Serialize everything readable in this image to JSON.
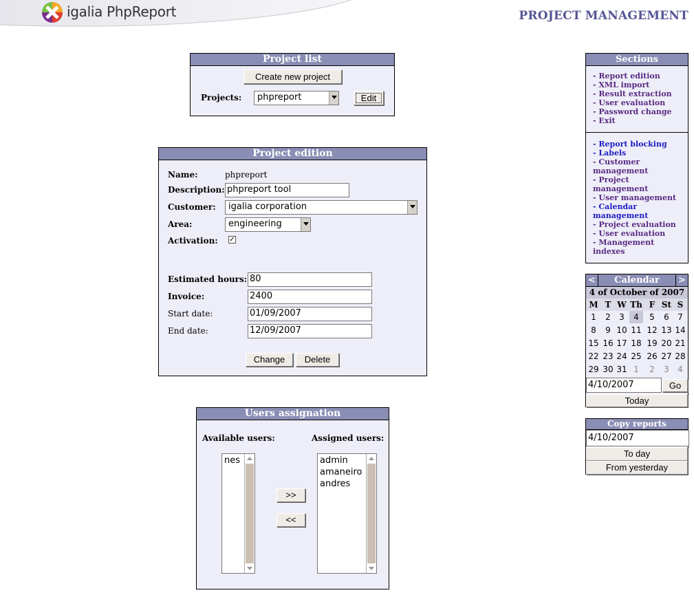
{
  "header": {
    "logo_text": "igalia PhpReport",
    "page_title": "PROJECT MANAGEMENT"
  },
  "project_list": {
    "title": "Project list",
    "create_button": "Create new project",
    "projects_label": "Projects:",
    "selected_project": "phpreport",
    "edit_button": "Edit"
  },
  "project_edition": {
    "title": "Project edition",
    "name_label": "Name:",
    "name_value": "phpreport",
    "description_label": "Description:",
    "description_value": "phpreport tool",
    "customer_label": "Customer:",
    "customer_value": "igalia corporation",
    "area_label": "Area:",
    "area_value": "engineering",
    "activation_label": "Activation:",
    "activation_checked": true,
    "estimated_hours_label": "Estimated hours:",
    "estimated_hours_value": "80",
    "invoice_label": "Invoice:",
    "invoice_value": "2400",
    "start_date_label": "Start date:",
    "start_date_value": "01/09/2007",
    "end_date_label": "End date:",
    "end_date_value": "12/09/2007",
    "change_button": "Change",
    "delete_button": "Delete"
  },
  "users_assignation": {
    "title": "Users assignation",
    "available_label": "Available users:",
    "assigned_label": "Assigned users:",
    "available_users": [
      "nes"
    ],
    "assigned_users": [
      "admin",
      "amaneiro",
      "andres"
    ],
    "add_button": ">>",
    "remove_button": "<<"
  },
  "sections": {
    "title": "Sections",
    "group1": [
      "- Report edition",
      "- XML import",
      "- Result extraction",
      "- User evaluation",
      "- Password change",
      "- Exit"
    ],
    "group2": [
      {
        "label": "- Report blocking",
        "visited": false
      },
      {
        "label": "- Labels",
        "visited": false
      },
      {
        "label": "- Customer management",
        "visited": true
      },
      {
        "label": "- Project management",
        "visited": true
      },
      {
        "label": "- User management",
        "visited": true
      },
      {
        "label": "- Calendar management",
        "visited": false
      },
      {
        "label": "- Project evaluation",
        "visited": true
      },
      {
        "label": "- User evaluation",
        "visited": true
      },
      {
        "label": "- Management indexes",
        "visited": true
      }
    ]
  },
  "calendar": {
    "prev": "<",
    "title": "Calendar",
    "next": ">",
    "current_date_text": "4 of October of 2007",
    "weekdays": [
      "M",
      "T",
      "W",
      "Th",
      "F",
      "St",
      "S"
    ],
    "weeks": [
      [
        "1",
        "2",
        "3",
        "4",
        "5",
        "6",
        "7"
      ],
      [
        "8",
        "9",
        "10",
        "11",
        "12",
        "13",
        "14"
      ],
      [
        "15",
        "16",
        "17",
        "18",
        "19",
        "20",
        "21"
      ],
      [
        "22",
        "23",
        "24",
        "25",
        "26",
        "27",
        "28"
      ],
      [
        "29",
        "30",
        "31",
        "1",
        "2",
        "3",
        "4"
      ]
    ],
    "selected_day": "4",
    "date_input": "4/10/2007",
    "go_button": "Go",
    "today_button": "Today"
  },
  "copy_reports": {
    "title": "Copy reports",
    "date_input": "4/10/2007",
    "to_day_button": "To day",
    "from_yesterday_button": "From yesterday"
  }
}
